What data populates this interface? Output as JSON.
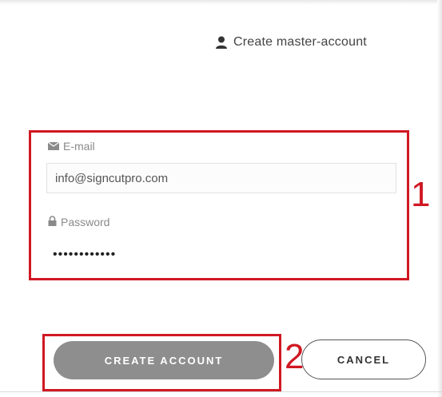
{
  "header": {
    "master_link_label": "Create master-account",
    "master_link_icon": "user-icon"
  },
  "form": {
    "email": {
      "label": "E-mail",
      "icon": "envelope-icon",
      "value": "info@signcutpro.com"
    },
    "password": {
      "label": "Password",
      "icon": "lock-icon",
      "value": "••••••••••••"
    }
  },
  "annotations": {
    "step_1": "1",
    "step_2": "2",
    "highlight_color": "#d01822"
  },
  "actions": {
    "create_label": "CREATE ACCOUNT",
    "cancel_label": "CANCEL"
  },
  "colors": {
    "primary_button": "#8e8e8e",
    "text": "#444444",
    "muted": "#8a8a8a"
  }
}
